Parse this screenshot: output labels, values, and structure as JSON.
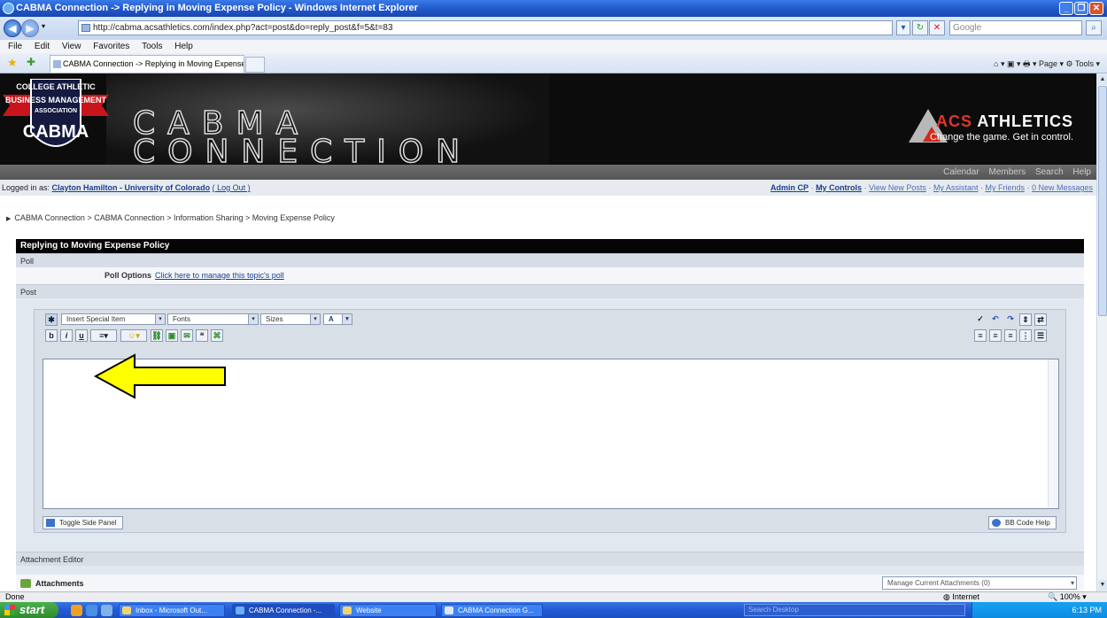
{
  "window": {
    "title": "CABMA Connection -> Replying in Moving Expense Policy - Windows Internet Explorer",
    "controls": [
      "_",
      "❐",
      "✕"
    ]
  },
  "browser": {
    "url": "http://cabma.acsathletics.com/index.php?act=post&do=reply_post&f=5&t=83",
    "search_placeholder": "Google",
    "menu": [
      "File",
      "Edit",
      "View",
      "Favorites",
      "Tools",
      "Help"
    ],
    "tab_title": "CABMA Connection -> Replying in Moving Expense Po...",
    "commands": "⌂ ▾ ▣ ▾ 🖶 ▾ Page ▾ ⚙ Tools ▾"
  },
  "banner": {
    "logo_lines": [
      "COLLEGE ATHLETIC",
      "BUSINESS MANAGEMENT",
      "ASSOCIATION",
      "CABMA"
    ],
    "title_line1": "CABMA",
    "title_line2": "CONNECTION",
    "sponsor_name_accent": "ACS",
    "sponsor_name": " ATHLETICS",
    "sponsor_tagline": "Change the game. Get in control."
  },
  "topnav": [
    "Calendar",
    "Members",
    "Search",
    "Help"
  ],
  "user": {
    "prefix": "Logged in as: ",
    "name": "Clayton Hamilton - University of Colorado",
    "logout": "( Log Out )",
    "links_bold": [
      "Admin CP",
      "My Controls"
    ],
    "links": [
      "View New Posts",
      "My Assistant",
      "My Friends",
      "0 New Messages"
    ]
  },
  "breadcrumb": "CABMA Connection > CABMA Connection > Information Sharing > Moving Expense Policy",
  "form": {
    "heading": "Replying to Moving Expense Policy",
    "poll_label": "Poll",
    "poll_options_label": "Poll Options",
    "poll_options_link": "Click here to manage this topic's poll",
    "post_label": "Post",
    "toolbar": {
      "special_item": "Insert Special Item",
      "fonts": "Fonts",
      "sizes": "Sizes",
      "color": "A"
    },
    "toggle_side_panel": "Toggle Side Panel",
    "bbcode_help": "BB Code Help",
    "attachment_editor": "Attachment Editor",
    "attachments": "Attachments",
    "manage_attachments": "Manage Current Attachments (0)"
  },
  "status": {
    "left": "Done",
    "zone": "Internet",
    "zoom": "100%"
  },
  "taskbar": {
    "start": "start",
    "tasks": [
      "Inbox - Microsoft Out...",
      "CABMA Connection -...",
      "Website",
      "CABMA Connection G..."
    ],
    "search_placeholder": "Search Desktop",
    "clock": "6:13 PM"
  },
  "colors": {
    "arrow_fill": "#ffff00",
    "header_black": "#050505",
    "accent_red": "#e3342a",
    "link_blue": "#1c3f8f"
  }
}
